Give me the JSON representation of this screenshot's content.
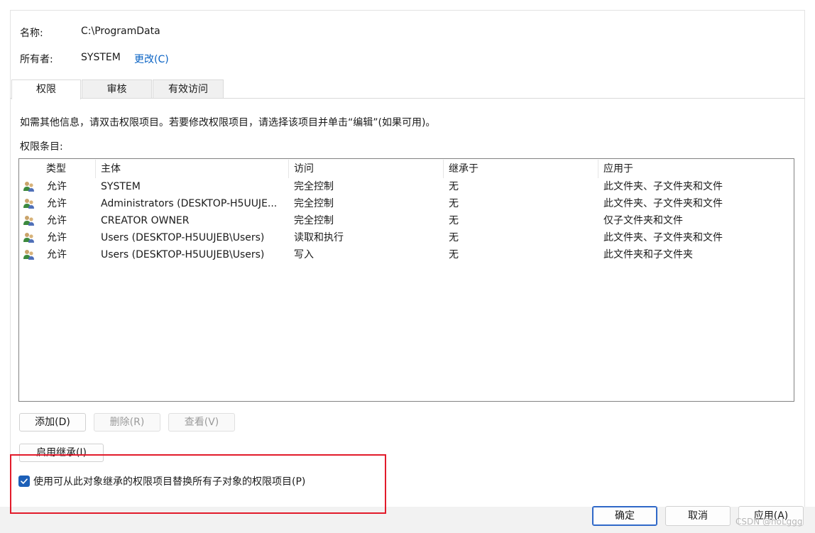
{
  "header": {
    "name_label": "名称:",
    "name_value": "C:\\ProgramData",
    "owner_label": "所有者:",
    "owner_value": "SYSTEM",
    "owner_change_link": "更改(C)"
  },
  "tabs": [
    {
      "label": "权限",
      "active": true
    },
    {
      "label": "审核",
      "active": false
    },
    {
      "label": "有效访问",
      "active": false
    }
  ],
  "info_text": "如需其他信息，请双击权限项目。若要修改权限项目，请选择该项目并单击“编辑”(如果可用)。",
  "list_label": "权限条目:",
  "columns": [
    "类型",
    "主体",
    "访问",
    "继承于",
    "应用于"
  ],
  "entries": [
    {
      "icon": "users-group-icon",
      "type": "允许",
      "principal": "SYSTEM",
      "access": "完全控制",
      "inherited_from": "无",
      "applies_to": "此文件夹、子文件夹和文件"
    },
    {
      "icon": "users-group-icon",
      "type": "允许",
      "principal": "Administrators (DESKTOP-H5UUJE...",
      "access": "完全控制",
      "inherited_from": "无",
      "applies_to": "此文件夹、子文件夹和文件"
    },
    {
      "icon": "users-group-icon",
      "type": "允许",
      "principal": "CREATOR OWNER",
      "access": "完全控制",
      "inherited_from": "无",
      "applies_to": "仅子文件夹和文件"
    },
    {
      "icon": "users-group-icon",
      "type": "允许",
      "principal": "Users (DESKTOP-H5UUJEB\\Users)",
      "access": "读取和执行",
      "inherited_from": "无",
      "applies_to": "此文件夹、子文件夹和文件"
    },
    {
      "icon": "users-group-icon",
      "type": "允许",
      "principal": "Users (DESKTOP-H5UUJEB\\Users)",
      "access": "写入",
      "inherited_from": "无",
      "applies_to": "此文件夹和子文件夹"
    }
  ],
  "buttons": {
    "add": "添加(D)",
    "remove": "删除(R)",
    "view": "查看(V)",
    "enable_inheritance": "启用继承(I)"
  },
  "replace_checkbox": {
    "label": "使用可从此对象继承的权限项目替换所有子对象的权限项目(P)",
    "checked": true
  },
  "footer": {
    "ok": "确定",
    "cancel": "取消",
    "apply": "应用(A)"
  },
  "watermark": "CSDN @hoLggg",
  "colors": {
    "accent": "#1c5fb8",
    "link": "#0a63c4",
    "highlight": "#e21b2b"
  }
}
